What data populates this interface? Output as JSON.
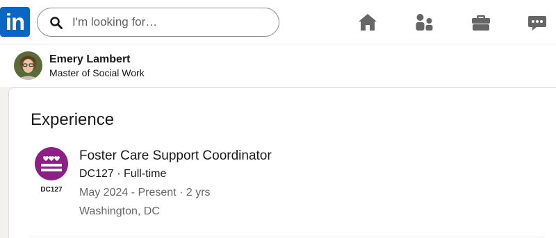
{
  "nav": {
    "logo_text": "in",
    "search": {
      "placeholder": "I'm looking for…",
      "value": ""
    },
    "icons": [
      "home-icon",
      "people-icon",
      "briefcase-icon",
      "messaging-icon"
    ],
    "brand_color": "#0a66c2",
    "icon_color": "#666666"
  },
  "profile": {
    "name": "Emery Lambert",
    "headline": "Master of Social Work"
  },
  "experience": {
    "title": "Experience",
    "items": [
      {
        "role": "Foster Care Support Coordinator",
        "company_line": "DC127 · Full-time",
        "dates": "May 2024 - Present · 2 yrs",
        "location": "Washington, DC",
        "logo_text": "DC127",
        "logo_color": "#8e1f86"
      }
    ]
  }
}
